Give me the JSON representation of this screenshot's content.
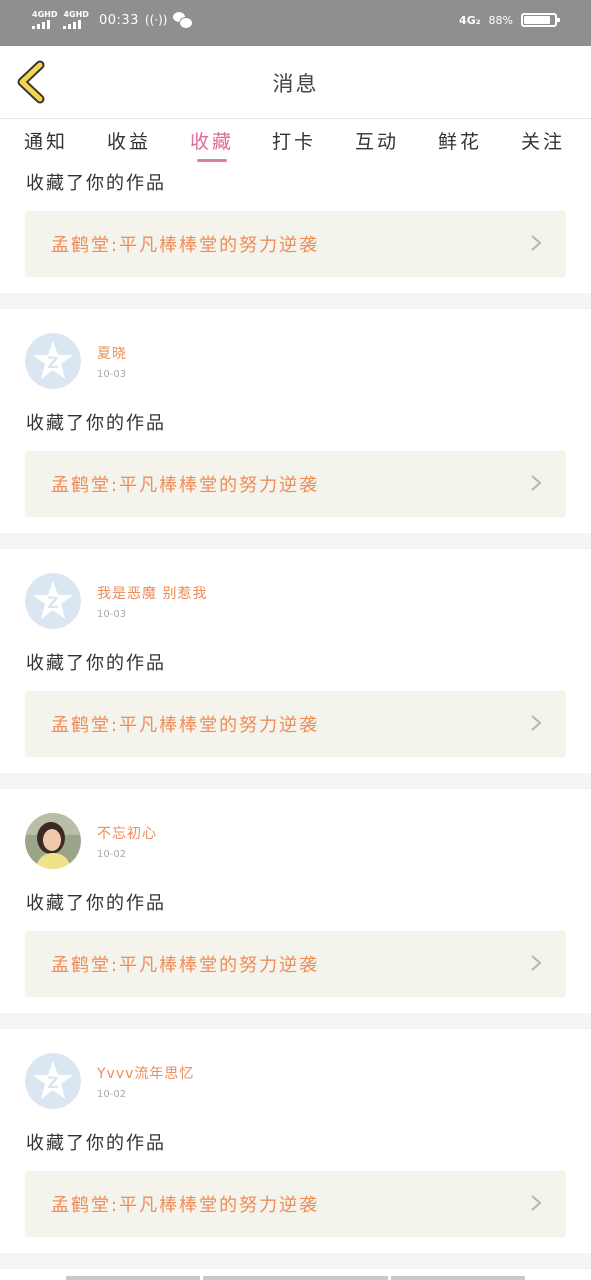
{
  "status_bar": {
    "net1": "4GHD",
    "net2": "4GHD",
    "time": "00:33",
    "hotspot": "((·))",
    "net_right": "4G₂",
    "battery": "88%",
    "battery_level": 0.88
  },
  "header": {
    "title": "消息"
  },
  "tabs": [
    "通知",
    "收益",
    "收藏",
    "打卡",
    "互动",
    "鲜花",
    "关注"
  ],
  "active_tab": 2,
  "partial_item": {
    "message": "收藏了你的作品",
    "work_title": "孟鹤堂:平凡棒棒堂的努力逆袭"
  },
  "items": [
    {
      "name": "夏晓",
      "date": "10-03",
      "avatar": "default-qq-avatar",
      "message": "收藏了你的作品",
      "work_title": "孟鹤堂:平凡棒棒堂的努力逆袭"
    },
    {
      "name": "我是恶魔 别惹我",
      "date": "10-03",
      "avatar": "default-qq-avatar",
      "message": "收藏了你的作品",
      "work_title": "孟鹤堂:平凡棒棒堂的努力逆袭"
    },
    {
      "name": "不忘初心",
      "date": "10-02",
      "avatar": "photo-avatar",
      "message": "收藏了你的作品",
      "work_title": "孟鹤堂:平凡棒棒堂的努力逆袭"
    },
    {
      "name": "Yvvv流年思忆",
      "date": "10-02",
      "avatar": "default-qq-avatar",
      "message": "收藏了你的作品",
      "work_title": "孟鹤堂:平凡棒棒堂的努力逆袭"
    }
  ],
  "colors": {
    "accent": "#e06a9a",
    "name_color": "#ee8c5b",
    "card_bg": "#f4f4ec",
    "status_bar": "#8f8f8f"
  }
}
